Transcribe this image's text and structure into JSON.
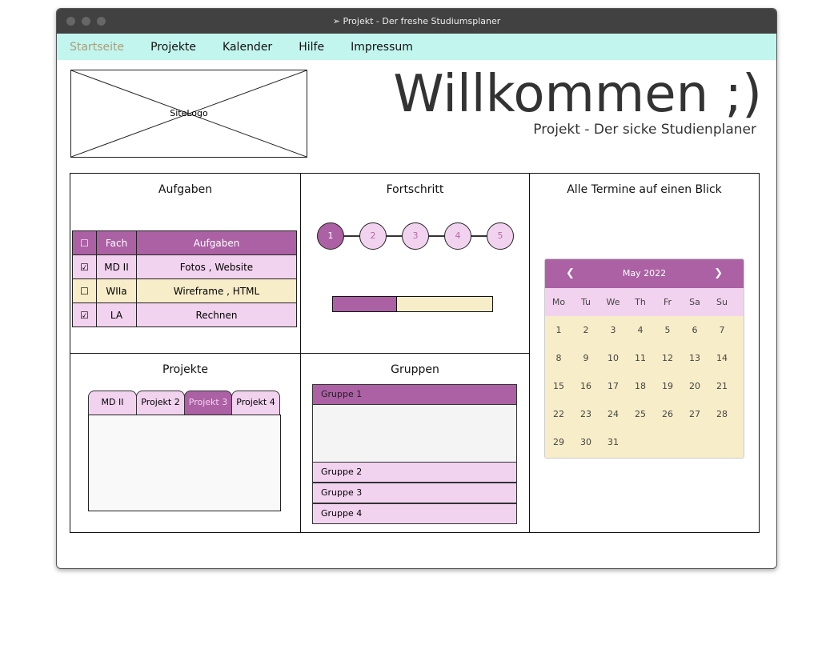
{
  "window": {
    "title": "Projekt - Der freshe Studiumsplaner"
  },
  "nav": {
    "items": [
      {
        "label": "Startseite",
        "active": true
      },
      {
        "label": "Projekte"
      },
      {
        "label": "Kalender"
      },
      {
        "label": "Hilfe"
      },
      {
        "label": "Impressum"
      }
    ]
  },
  "header": {
    "logo": "SiteLogo",
    "title": "Willkommen ;)",
    "subtitle": "Projekt - Der sicke Studienplaner"
  },
  "aufgaben": {
    "title": "Aufgaben",
    "headers": [
      "Fach",
      "Aufgaben"
    ],
    "rows": [
      {
        "checked": true,
        "fach": "MD II",
        "aufgaben": "Fotos , Website"
      },
      {
        "checked": false,
        "fach": "WIIa",
        "aufgaben": "Wireframe , HTML"
      },
      {
        "checked": true,
        "fach": "LA",
        "aufgaben": "Rechnen"
      }
    ]
  },
  "fortschritt": {
    "title": "Fortschritt",
    "steps": [
      "1",
      "2",
      "3",
      "4",
      "5"
    ],
    "active_step": 1,
    "progress_percent": 40
  },
  "termine": {
    "title": "Alle Termine auf einen Blick",
    "calendar": {
      "month": "May 2022",
      "prev": "❮",
      "next": "❯",
      "weekdays": [
        "Mo",
        "Tu",
        "We",
        "Th",
        "Fr",
        "Sa",
        "Su"
      ],
      "weeks": [
        [
          "1",
          "2",
          "3",
          "4",
          "5",
          "6",
          "7"
        ],
        [
          "8",
          "9",
          "10",
          "11",
          "12",
          "13",
          "14"
        ],
        [
          "15",
          "16",
          "17",
          "18",
          "19",
          "20",
          "21"
        ],
        [
          "22",
          "23",
          "24",
          "25",
          "26",
          "27",
          "28"
        ],
        [
          "29",
          "30",
          "31",
          "",
          "",
          "",
          ""
        ]
      ]
    }
  },
  "projekte": {
    "title": "Projekte",
    "tabs": [
      "MD II",
      "Projekt 2",
      "Projekt 3",
      "Projekt 4"
    ],
    "active_tab": "Projekt 3"
  },
  "gruppen": {
    "title": "Gruppen",
    "items": [
      "Gruppe 1",
      "Gruppe 2",
      "Gruppe 3",
      "Gruppe 4"
    ],
    "expanded": "Gruppe 1"
  },
  "colors": {
    "accent": "#ab61a3",
    "light": "#f2d3ef",
    "cream": "#f7edc8",
    "nav": "#c3f5ef"
  }
}
